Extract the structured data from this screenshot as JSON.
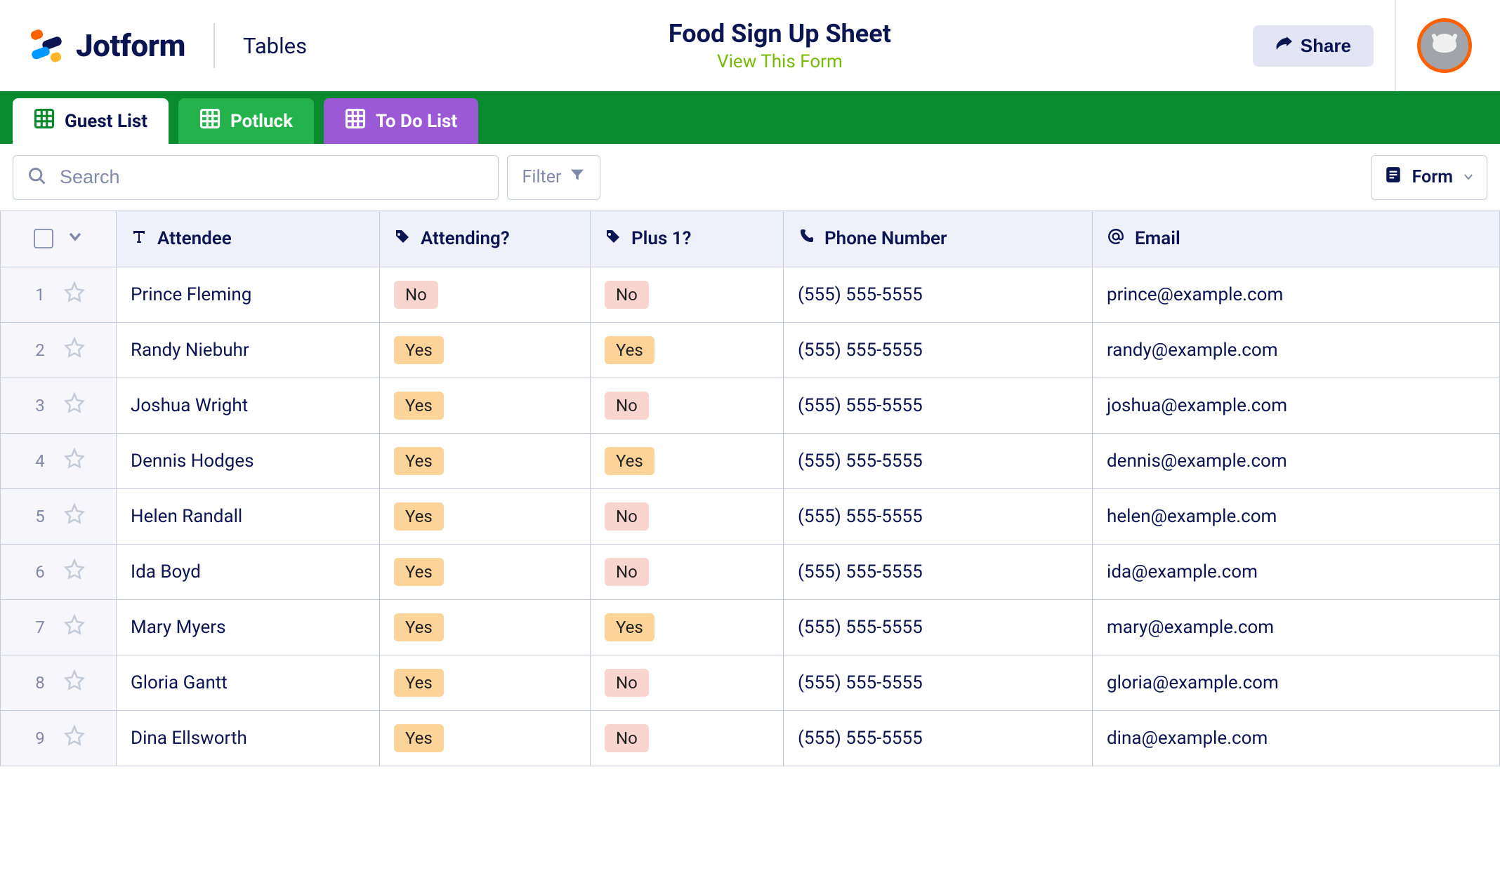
{
  "header": {
    "logo_text": "Jotform",
    "app_name": "Tables",
    "form_title": "Food Sign Up Sheet",
    "view_form_link": "View This Form",
    "share_label": "Share"
  },
  "tabs": [
    {
      "label": "Guest List",
      "color": "active"
    },
    {
      "label": "Potluck",
      "color": "green"
    },
    {
      "label": "To Do List",
      "color": "purple"
    }
  ],
  "toolbar": {
    "search_placeholder": "Search",
    "filter_label": "Filter",
    "view_selector_label": "Form"
  },
  "columns": [
    {
      "label": "Attendee",
      "icon": "text-icon"
    },
    {
      "label": "Attending?",
      "icon": "tag-icon"
    },
    {
      "label": "Plus 1?",
      "icon": "tag-icon"
    },
    {
      "label": "Phone Number",
      "icon": "phone-icon"
    },
    {
      "label": "Email",
      "icon": "at-icon"
    }
  ],
  "rows": [
    {
      "num": "1",
      "attendee": "Prince Fleming",
      "attending": "No",
      "plus1": "No",
      "phone": "(555) 555-5555",
      "email": "prince@example.com"
    },
    {
      "num": "2",
      "attendee": "Randy Niebuhr",
      "attending": "Yes",
      "plus1": "Yes",
      "phone": "(555) 555-5555",
      "email": "randy@example.com"
    },
    {
      "num": "3",
      "attendee": "Joshua Wright",
      "attending": "Yes",
      "plus1": "No",
      "phone": "(555) 555-5555",
      "email": "joshua@example.com"
    },
    {
      "num": "4",
      "attendee": "Dennis Hodges",
      "attending": "Yes",
      "plus1": "Yes",
      "phone": "(555) 555-5555",
      "email": "dennis@example.com"
    },
    {
      "num": "5",
      "attendee": "Helen Randall",
      "attending": "Yes",
      "plus1": "No",
      "phone": "(555) 555-5555",
      "email": "helen@example.com"
    },
    {
      "num": "6",
      "attendee": "Ida Boyd",
      "attending": "Yes",
      "plus1": "No",
      "phone": "(555) 555-5555",
      "email": "ida@example.com"
    },
    {
      "num": "7",
      "attendee": "Mary Myers",
      "attending": "Yes",
      "plus1": "Yes",
      "phone": "(555) 555-5555",
      "email": "mary@example.com"
    },
    {
      "num": "8",
      "attendee": "Gloria Gantt",
      "attending": "Yes",
      "plus1": "No",
      "phone": "(555) 555-5555",
      "email": "gloria@example.com"
    },
    {
      "num": "9",
      "attendee": "Dina Ellsworth",
      "attending": "Yes",
      "plus1": "No",
      "phone": "(555) 555-5555",
      "email": "dina@example.com"
    }
  ]
}
